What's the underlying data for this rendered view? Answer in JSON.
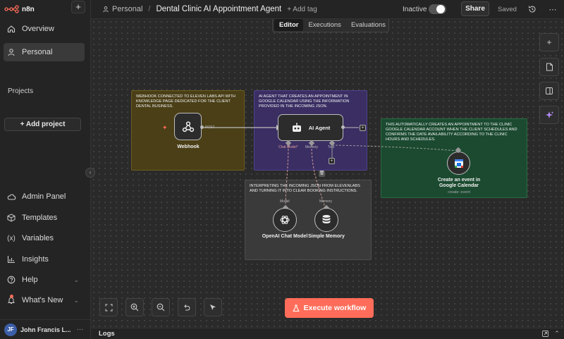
{
  "app": {
    "brand": "n8n",
    "accent": "#ff6d5a"
  },
  "sidebar": {
    "new_button": "+",
    "nav_top": [
      {
        "label": "Overview",
        "icon": "home-icon"
      },
      {
        "label": "Personal",
        "icon": "user-icon",
        "active": true
      }
    ],
    "projects_label": "Projects",
    "add_project_label": "+ Add project",
    "nav_bottom": [
      {
        "label": "Admin Panel",
        "icon": "cloud-icon"
      },
      {
        "label": "Templates",
        "icon": "box-icon"
      },
      {
        "label": "Variables",
        "icon": "variables-icon"
      },
      {
        "label": "Insights",
        "icon": "chart-icon"
      },
      {
        "label": "Help",
        "icon": "help-icon"
      },
      {
        "label": "What's New",
        "icon": "bell-icon"
      }
    ],
    "user": {
      "initials": "JF",
      "name": "John Francis L...",
      "more": "···"
    }
  },
  "header": {
    "breadcrumb_project": "Personal",
    "breadcrumb_sep": "/",
    "workflow_name": "Dental Clinic AI Appointment Agent",
    "add_tag": "+ Add tag",
    "active_state_label": "Inactive",
    "share_label": "Share",
    "save_state": "Saved"
  },
  "tabs": [
    {
      "label": "Editor",
      "active": true
    },
    {
      "label": "Executions"
    },
    {
      "label": "Evaluations"
    }
  ],
  "notes": {
    "webhook": "Webhook connected to Eleven Labs API with knowledge page dedicated for the client dental business.",
    "agent": "AI agent that creates an appointment in google calendar using the information provided in the incoming json.",
    "calendar": "This automatically creates an appointment to the clinic google calendar account when the client schedules and confirms the date availability according to the clinic hours and schedules.",
    "model": "Interpreting the incoming JSON from elevenlabs and turning it into clear booking instructions."
  },
  "nodes": {
    "webhook": {
      "label": "Webhook",
      "port_label": "POST"
    },
    "agent": {
      "label": "AI Agent",
      "ports": [
        "Chat Model*",
        "Memory",
        "Tool"
      ]
    },
    "calendar": {
      "label_line1": "Create an event in",
      "label_line2": "Google Calendar",
      "subtitle": "create: event"
    },
    "openai": {
      "label": "OpenAI Chat Model",
      "port_label": "Model"
    },
    "memory": {
      "label": "Simple Memory",
      "port_label": "Memory"
    }
  },
  "canvas": {
    "execute_label": "Execute workflow",
    "right_tools": [
      "plus-icon",
      "sticky-note-icon",
      "panel-icon",
      "sparkle-icon"
    ],
    "bottom_tools": [
      "fit-view-icon",
      "zoom-in-icon",
      "zoom-out-icon",
      "undo-icon",
      "pointer-icon"
    ]
  },
  "logs": {
    "label": "Logs"
  }
}
